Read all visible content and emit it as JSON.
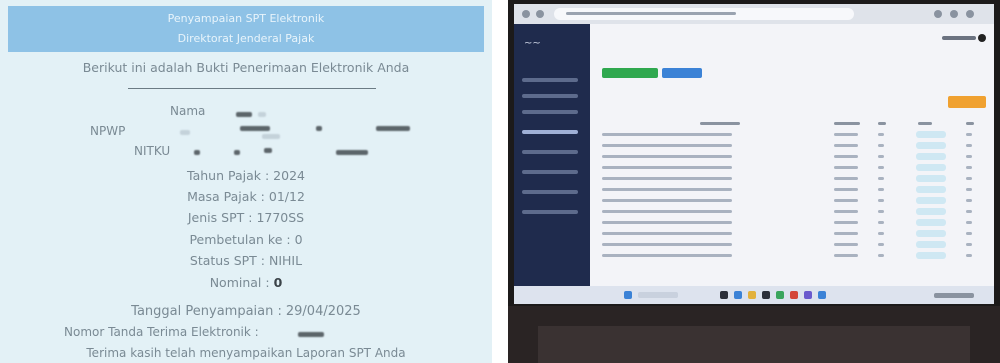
{
  "receipt": {
    "header_line1": "Penyampaian SPT Elektronik",
    "header_line2": "Direktorat Jenderal Pajak",
    "intro": "Berikut ini adalah Bukti Penerimaan Elektronik Anda",
    "labels": {
      "nama": "Nama",
      "npwp": "NPWP",
      "nitku": "NITKU"
    },
    "fields": [
      {
        "label": "Tahun Pajak :",
        "value": "2024"
      },
      {
        "label": "Masa Pajak :",
        "value": "01/12"
      },
      {
        "label": "Jenis SPT :",
        "value": "1770SS"
      },
      {
        "label": "Pembetulan ke :",
        "value": "0"
      },
      {
        "label": "Status SPT :",
        "value": "NIHIL"
      }
    ],
    "nominal_label": "Nominal :",
    "nominal_value": "0",
    "date_label": "Tanggal Penyampaian :",
    "date_value": "29/04/2025",
    "ntte_label": "Nomor Tanda Terima Elektronik :",
    "closing": "Terima kasih telah menyampaikan Laporan SPT Anda"
  },
  "laptop": {
    "colors": {
      "sidebar": "#1f2b4d",
      "green_button": "#2fa84f",
      "blue_button": "#3b82d6",
      "orange_button": "#f0a130"
    },
    "table_rows": 12
  }
}
